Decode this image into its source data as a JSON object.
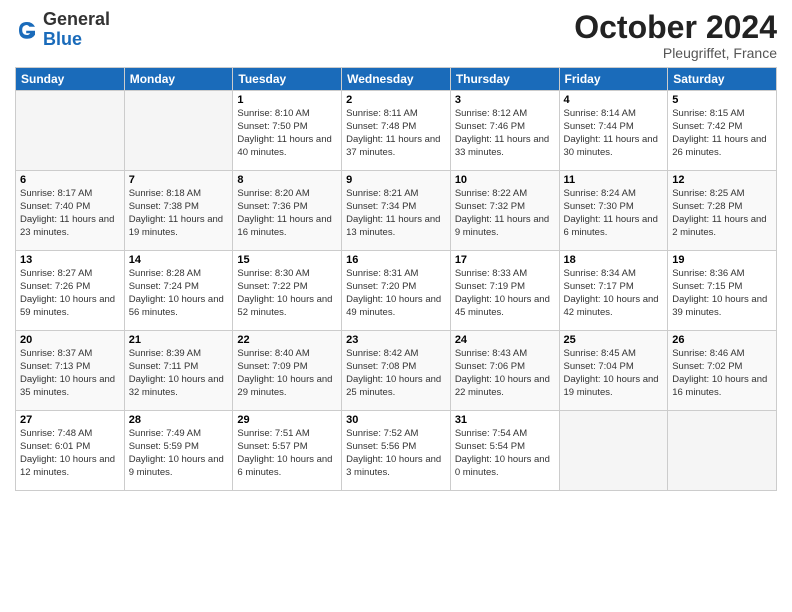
{
  "header": {
    "logo": {
      "general": "General",
      "blue": "Blue"
    },
    "month": "October 2024",
    "location": "Pleugriffet, France"
  },
  "days_of_week": [
    "Sunday",
    "Monday",
    "Tuesday",
    "Wednesday",
    "Thursday",
    "Friday",
    "Saturday"
  ],
  "weeks": [
    [
      {
        "day": "",
        "empty": true
      },
      {
        "day": "",
        "empty": true
      },
      {
        "day": "1",
        "sunrise": "Sunrise: 8:10 AM",
        "sunset": "Sunset: 7:50 PM",
        "daylight": "Daylight: 11 hours and 40 minutes."
      },
      {
        "day": "2",
        "sunrise": "Sunrise: 8:11 AM",
        "sunset": "Sunset: 7:48 PM",
        "daylight": "Daylight: 11 hours and 37 minutes."
      },
      {
        "day": "3",
        "sunrise": "Sunrise: 8:12 AM",
        "sunset": "Sunset: 7:46 PM",
        "daylight": "Daylight: 11 hours and 33 minutes."
      },
      {
        "day": "4",
        "sunrise": "Sunrise: 8:14 AM",
        "sunset": "Sunset: 7:44 PM",
        "daylight": "Daylight: 11 hours and 30 minutes."
      },
      {
        "day": "5",
        "sunrise": "Sunrise: 8:15 AM",
        "sunset": "Sunset: 7:42 PM",
        "daylight": "Daylight: 11 hours and 26 minutes."
      }
    ],
    [
      {
        "day": "6",
        "sunrise": "Sunrise: 8:17 AM",
        "sunset": "Sunset: 7:40 PM",
        "daylight": "Daylight: 11 hours and 23 minutes."
      },
      {
        "day": "7",
        "sunrise": "Sunrise: 8:18 AM",
        "sunset": "Sunset: 7:38 PM",
        "daylight": "Daylight: 11 hours and 19 minutes."
      },
      {
        "day": "8",
        "sunrise": "Sunrise: 8:20 AM",
        "sunset": "Sunset: 7:36 PM",
        "daylight": "Daylight: 11 hours and 16 minutes."
      },
      {
        "day": "9",
        "sunrise": "Sunrise: 8:21 AM",
        "sunset": "Sunset: 7:34 PM",
        "daylight": "Daylight: 11 hours and 13 minutes."
      },
      {
        "day": "10",
        "sunrise": "Sunrise: 8:22 AM",
        "sunset": "Sunset: 7:32 PM",
        "daylight": "Daylight: 11 hours and 9 minutes."
      },
      {
        "day": "11",
        "sunrise": "Sunrise: 8:24 AM",
        "sunset": "Sunset: 7:30 PM",
        "daylight": "Daylight: 11 hours and 6 minutes."
      },
      {
        "day": "12",
        "sunrise": "Sunrise: 8:25 AM",
        "sunset": "Sunset: 7:28 PM",
        "daylight": "Daylight: 11 hours and 2 minutes."
      }
    ],
    [
      {
        "day": "13",
        "sunrise": "Sunrise: 8:27 AM",
        "sunset": "Sunset: 7:26 PM",
        "daylight": "Daylight: 10 hours and 59 minutes."
      },
      {
        "day": "14",
        "sunrise": "Sunrise: 8:28 AM",
        "sunset": "Sunset: 7:24 PM",
        "daylight": "Daylight: 10 hours and 56 minutes."
      },
      {
        "day": "15",
        "sunrise": "Sunrise: 8:30 AM",
        "sunset": "Sunset: 7:22 PM",
        "daylight": "Daylight: 10 hours and 52 minutes."
      },
      {
        "day": "16",
        "sunrise": "Sunrise: 8:31 AM",
        "sunset": "Sunset: 7:20 PM",
        "daylight": "Daylight: 10 hours and 49 minutes."
      },
      {
        "day": "17",
        "sunrise": "Sunrise: 8:33 AM",
        "sunset": "Sunset: 7:19 PM",
        "daylight": "Daylight: 10 hours and 45 minutes."
      },
      {
        "day": "18",
        "sunrise": "Sunrise: 8:34 AM",
        "sunset": "Sunset: 7:17 PM",
        "daylight": "Daylight: 10 hours and 42 minutes."
      },
      {
        "day": "19",
        "sunrise": "Sunrise: 8:36 AM",
        "sunset": "Sunset: 7:15 PM",
        "daylight": "Daylight: 10 hours and 39 minutes."
      }
    ],
    [
      {
        "day": "20",
        "sunrise": "Sunrise: 8:37 AM",
        "sunset": "Sunset: 7:13 PM",
        "daylight": "Daylight: 10 hours and 35 minutes."
      },
      {
        "day": "21",
        "sunrise": "Sunrise: 8:39 AM",
        "sunset": "Sunset: 7:11 PM",
        "daylight": "Daylight: 10 hours and 32 minutes."
      },
      {
        "day": "22",
        "sunrise": "Sunrise: 8:40 AM",
        "sunset": "Sunset: 7:09 PM",
        "daylight": "Daylight: 10 hours and 29 minutes."
      },
      {
        "day": "23",
        "sunrise": "Sunrise: 8:42 AM",
        "sunset": "Sunset: 7:08 PM",
        "daylight": "Daylight: 10 hours and 25 minutes."
      },
      {
        "day": "24",
        "sunrise": "Sunrise: 8:43 AM",
        "sunset": "Sunset: 7:06 PM",
        "daylight": "Daylight: 10 hours and 22 minutes."
      },
      {
        "day": "25",
        "sunrise": "Sunrise: 8:45 AM",
        "sunset": "Sunset: 7:04 PM",
        "daylight": "Daylight: 10 hours and 19 minutes."
      },
      {
        "day": "26",
        "sunrise": "Sunrise: 8:46 AM",
        "sunset": "Sunset: 7:02 PM",
        "daylight": "Daylight: 10 hours and 16 minutes."
      }
    ],
    [
      {
        "day": "27",
        "sunrise": "Sunrise: 7:48 AM",
        "sunset": "Sunset: 6:01 PM",
        "daylight": "Daylight: 10 hours and 12 minutes."
      },
      {
        "day": "28",
        "sunrise": "Sunrise: 7:49 AM",
        "sunset": "Sunset: 5:59 PM",
        "daylight": "Daylight: 10 hours and 9 minutes."
      },
      {
        "day": "29",
        "sunrise": "Sunrise: 7:51 AM",
        "sunset": "Sunset: 5:57 PM",
        "daylight": "Daylight: 10 hours and 6 minutes."
      },
      {
        "day": "30",
        "sunrise": "Sunrise: 7:52 AM",
        "sunset": "Sunset: 5:56 PM",
        "daylight": "Daylight: 10 hours and 3 minutes."
      },
      {
        "day": "31",
        "sunrise": "Sunrise: 7:54 AM",
        "sunset": "Sunset: 5:54 PM",
        "daylight": "Daylight: 10 hours and 0 minutes."
      },
      {
        "day": "",
        "empty": true
      },
      {
        "day": "",
        "empty": true
      }
    ]
  ]
}
